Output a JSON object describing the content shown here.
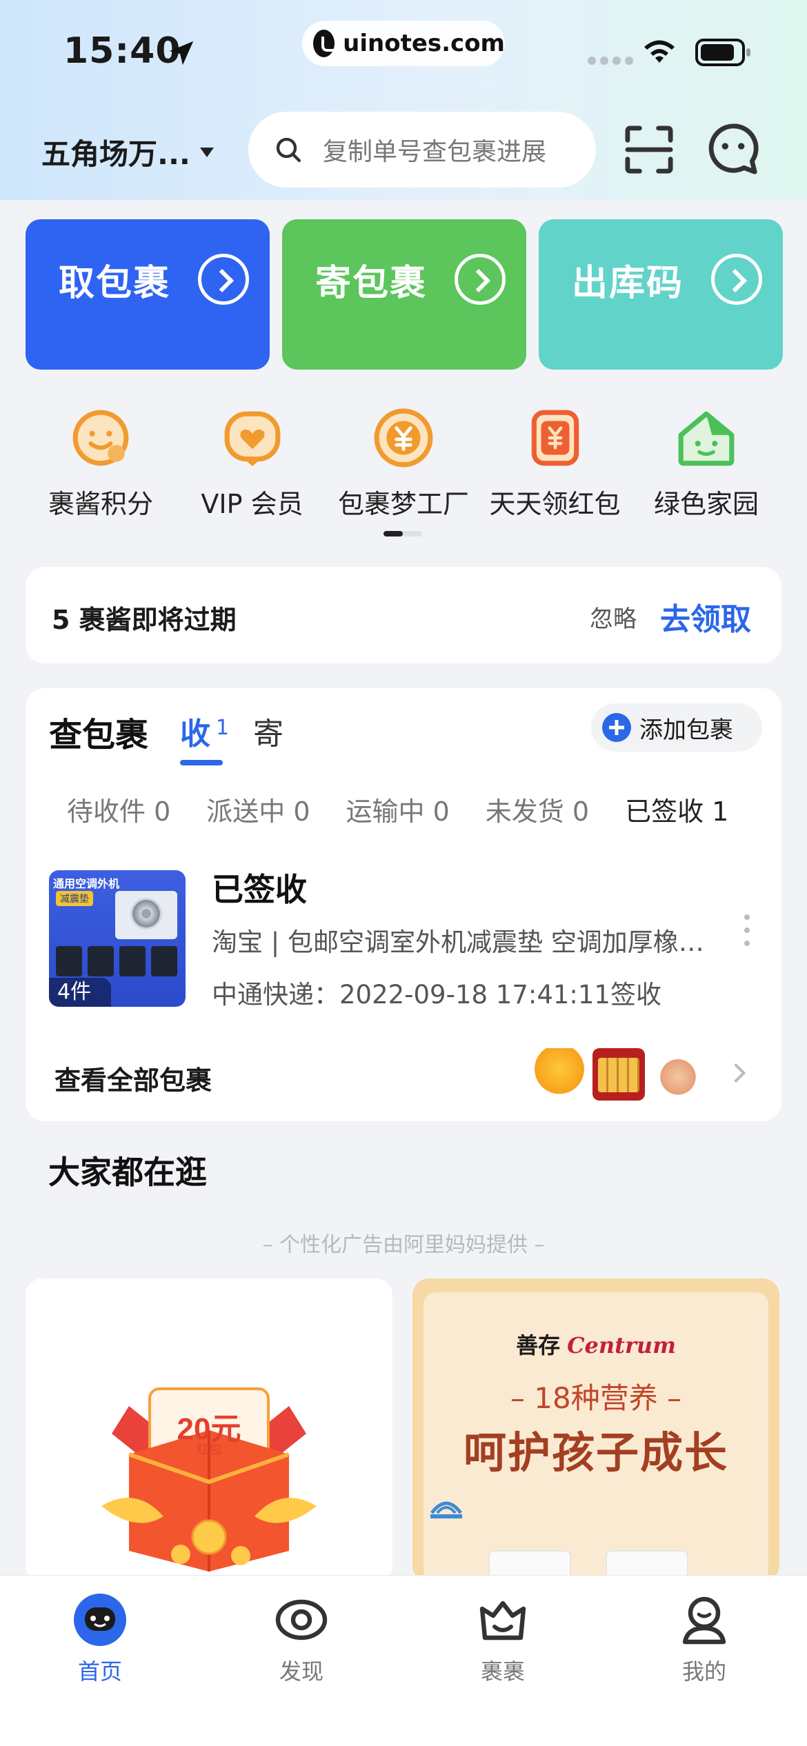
{
  "status_bar": {
    "time": "15:40",
    "url": "uinotes.com"
  },
  "header": {
    "location": "五角场万...",
    "search_placeholder": "复制单号查包裹进展"
  },
  "actions": [
    {
      "label": "取包裹",
      "color": "#2f64f2"
    },
    {
      "label": "寄包裹",
      "color": "#5cc55b"
    },
    {
      "label": "出库码",
      "color": "#62d3c9"
    }
  ],
  "quick": [
    {
      "label": "裹酱积分",
      "icon": "smiley-coin-icon"
    },
    {
      "label": "VIP 会员",
      "icon": "vip-heart-icon"
    },
    {
      "label": "包裹梦工厂",
      "icon": "yuan-coin-icon"
    },
    {
      "label": "天天领红包",
      "icon": "red-envelope-icon"
    },
    {
      "label": "绿色家园",
      "icon": "green-house-icon"
    }
  ],
  "points_banner": {
    "text": "5 裹酱即将过期",
    "ignore": "忽略",
    "claim": "去领取"
  },
  "parcels": {
    "title": "查包裹",
    "tab_receive": "收",
    "tab_receive_count": "1",
    "tab_send": "寄",
    "add_button": "添加包裹",
    "status_tabs": [
      "待收件 0",
      "派送中 0",
      "运输中 0",
      "未发货 0",
      "已签收 1"
    ],
    "active_status": 4,
    "item": {
      "thumb_header": "通用空调外机",
      "thumb_tag": "减震垫",
      "count": "4件",
      "status": "已签收",
      "desc": "淘宝 | 包邮空调室外机减震垫 空调加厚橡胶垫",
      "courier": "中通快递：2022-09-18 17:41:11签收"
    },
    "view_all": "查看全部包裹"
  },
  "browse": {
    "title": "大家都在逛",
    "ad_note": "– 个性化广告由阿里妈妈提供 –",
    "left_card": {
      "amount": "20元",
      "sub": "红包"
    },
    "right_card": {
      "brand_cn": "善存",
      "brand_en": "Centrum",
      "sub": "– 18种营养 –",
      "main": "呵护孩子成长"
    }
  },
  "bottom_nav": [
    {
      "label": "首页",
      "active": true
    },
    {
      "label": "发现",
      "active": false
    },
    {
      "label": "裹裹",
      "active": false
    },
    {
      "label": "我的",
      "active": false
    }
  ],
  "colors": {
    "accent": "#2b67e8",
    "pickup": "#2f64f2",
    "send": "#5cc55b",
    "outbound": "#62d3c9"
  }
}
